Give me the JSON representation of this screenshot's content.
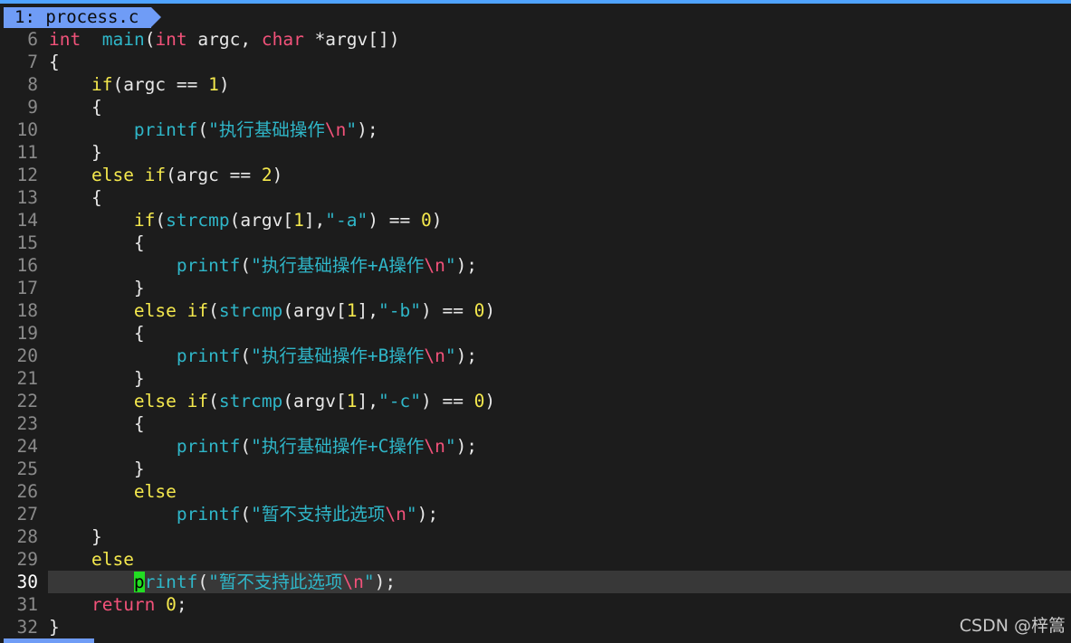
{
  "tab": {
    "label": "1: process.c"
  },
  "editor": {
    "current_line": 30,
    "lines": [
      {
        "n": "6",
        "tokens": [
          [
            "k-red",
            "int"
          ],
          [
            "",
            "  "
          ],
          [
            "k-fn",
            "main"
          ],
          [
            "",
            "("
          ],
          [
            "k-red",
            "int"
          ],
          [
            "",
            " argc, "
          ],
          [
            "k-red",
            "char"
          ],
          [
            "",
            " *argv[])"
          ]
        ]
      },
      {
        "n": "7",
        "tokens": [
          [
            "",
            "{"
          ]
        ]
      },
      {
        "n": "8",
        "tokens": [
          [
            "",
            "    "
          ],
          [
            "k-yel",
            "if"
          ],
          [
            "",
            "(argc == "
          ],
          [
            "k-num",
            "1"
          ],
          [
            "",
            ")"
          ]
        ]
      },
      {
        "n": "9",
        "tokens": [
          [
            "",
            "    {"
          ]
        ]
      },
      {
        "n": "10",
        "tokens": [
          [
            "",
            "        "
          ],
          [
            "k-fn",
            "printf"
          ],
          [
            "",
            "("
          ],
          [
            "k-str",
            "\"执行基础操作"
          ],
          [
            "k-esc",
            "\\n"
          ],
          [
            "k-str",
            "\""
          ],
          [
            "",
            ");"
          ]
        ]
      },
      {
        "n": "11",
        "tokens": [
          [
            "",
            "    }"
          ]
        ]
      },
      {
        "n": "12",
        "tokens": [
          [
            "",
            "    "
          ],
          [
            "k-yel",
            "else if"
          ],
          [
            "",
            "(argc == "
          ],
          [
            "k-num",
            "2"
          ],
          [
            "",
            ")"
          ]
        ]
      },
      {
        "n": "13",
        "tokens": [
          [
            "",
            "    {"
          ]
        ]
      },
      {
        "n": "14",
        "tokens": [
          [
            "",
            "        "
          ],
          [
            "k-yel",
            "if"
          ],
          [
            "",
            "("
          ],
          [
            "k-fn",
            "strcmp"
          ],
          [
            "",
            "(argv["
          ],
          [
            "k-num",
            "1"
          ],
          [
            "",
            "],"
          ],
          [
            "k-str",
            "\"-a\""
          ],
          [
            "",
            ") == "
          ],
          [
            "k-num",
            "0"
          ],
          [
            "",
            ")"
          ]
        ]
      },
      {
        "n": "15",
        "tokens": [
          [
            "",
            "        {"
          ]
        ]
      },
      {
        "n": "16",
        "tokens": [
          [
            "",
            "            "
          ],
          [
            "k-fn",
            "printf"
          ],
          [
            "",
            "("
          ],
          [
            "k-str",
            "\"执行基础操作+A操作"
          ],
          [
            "k-esc",
            "\\n"
          ],
          [
            "k-str",
            "\""
          ],
          [
            "",
            ");"
          ]
        ]
      },
      {
        "n": "17",
        "tokens": [
          [
            "",
            "        }"
          ]
        ]
      },
      {
        "n": "18",
        "tokens": [
          [
            "",
            "        "
          ],
          [
            "k-yel",
            "else if"
          ],
          [
            "",
            "("
          ],
          [
            "k-fn",
            "strcmp"
          ],
          [
            "",
            "(argv["
          ],
          [
            "k-num",
            "1"
          ],
          [
            "",
            "],"
          ],
          [
            "k-str",
            "\"-b\""
          ],
          [
            "",
            ") == "
          ],
          [
            "k-num",
            "0"
          ],
          [
            "",
            ")"
          ]
        ]
      },
      {
        "n": "19",
        "tokens": [
          [
            "",
            "        {"
          ]
        ]
      },
      {
        "n": "20",
        "tokens": [
          [
            "",
            "            "
          ],
          [
            "k-fn",
            "printf"
          ],
          [
            "",
            "("
          ],
          [
            "k-str",
            "\"执行基础操作+B操作"
          ],
          [
            "k-esc",
            "\\n"
          ],
          [
            "k-str",
            "\""
          ],
          [
            "",
            ");"
          ]
        ]
      },
      {
        "n": "21",
        "tokens": [
          [
            "",
            "        }"
          ]
        ]
      },
      {
        "n": "22",
        "tokens": [
          [
            "",
            "        "
          ],
          [
            "k-yel",
            "else if"
          ],
          [
            "",
            "("
          ],
          [
            "k-fn",
            "strcmp"
          ],
          [
            "",
            "(argv["
          ],
          [
            "k-num",
            "1"
          ],
          [
            "",
            "],"
          ],
          [
            "k-str",
            "\"-c\""
          ],
          [
            "",
            ") == "
          ],
          [
            "k-num",
            "0"
          ],
          [
            "",
            ")"
          ]
        ]
      },
      {
        "n": "23",
        "tokens": [
          [
            "",
            "        {"
          ]
        ]
      },
      {
        "n": "24",
        "tokens": [
          [
            "",
            "            "
          ],
          [
            "k-fn",
            "printf"
          ],
          [
            "",
            "("
          ],
          [
            "k-str",
            "\"执行基础操作+C操作"
          ],
          [
            "k-esc",
            "\\n"
          ],
          [
            "k-str",
            "\""
          ],
          [
            "",
            ");"
          ]
        ]
      },
      {
        "n": "25",
        "tokens": [
          [
            "",
            "        }"
          ]
        ]
      },
      {
        "n": "26",
        "tokens": [
          [
            "",
            "        "
          ],
          [
            "k-yel",
            "else"
          ]
        ]
      },
      {
        "n": "27",
        "tokens": [
          [
            "",
            "            "
          ],
          [
            "k-fn",
            "printf"
          ],
          [
            "",
            "("
          ],
          [
            "k-str",
            "\"暂不支持此选项"
          ],
          [
            "k-esc",
            "\\n"
          ],
          [
            "k-str",
            "\""
          ],
          [
            "",
            ");"
          ]
        ]
      },
      {
        "n": "28",
        "tokens": [
          [
            "",
            "    }"
          ]
        ]
      },
      {
        "n": "29",
        "tokens": [
          [
            "",
            "    "
          ],
          [
            "k-yel",
            "else"
          ]
        ]
      },
      {
        "n": "30",
        "tokens": [
          [
            "",
            "        "
          ],
          [
            "cursor",
            "p"
          ],
          [
            "k-fn",
            "rintf"
          ],
          [
            "",
            "("
          ],
          [
            "k-str",
            "\"暂不支持此选项"
          ],
          [
            "k-esc",
            "\\n"
          ],
          [
            "k-str",
            "\""
          ],
          [
            "",
            ");"
          ]
        ]
      },
      {
        "n": "31",
        "tokens": [
          [
            "",
            "    "
          ],
          [
            "k-red",
            "return"
          ],
          [
            "",
            " "
          ],
          [
            "k-num",
            "0"
          ],
          [
            "",
            ";"
          ]
        ]
      },
      {
        "n": "32",
        "tokens": [
          [
            "",
            "}"
          ]
        ]
      }
    ]
  },
  "watermark": "CSDN @梓篙",
  "colors": {
    "background": "#1c1c1c",
    "tab": "#6f9cf6",
    "keyword_red": "#f2527a",
    "keyword_yellow": "#f4e84d",
    "function_cyan": "#2fb6c8",
    "cursor": "#22dd22"
  }
}
